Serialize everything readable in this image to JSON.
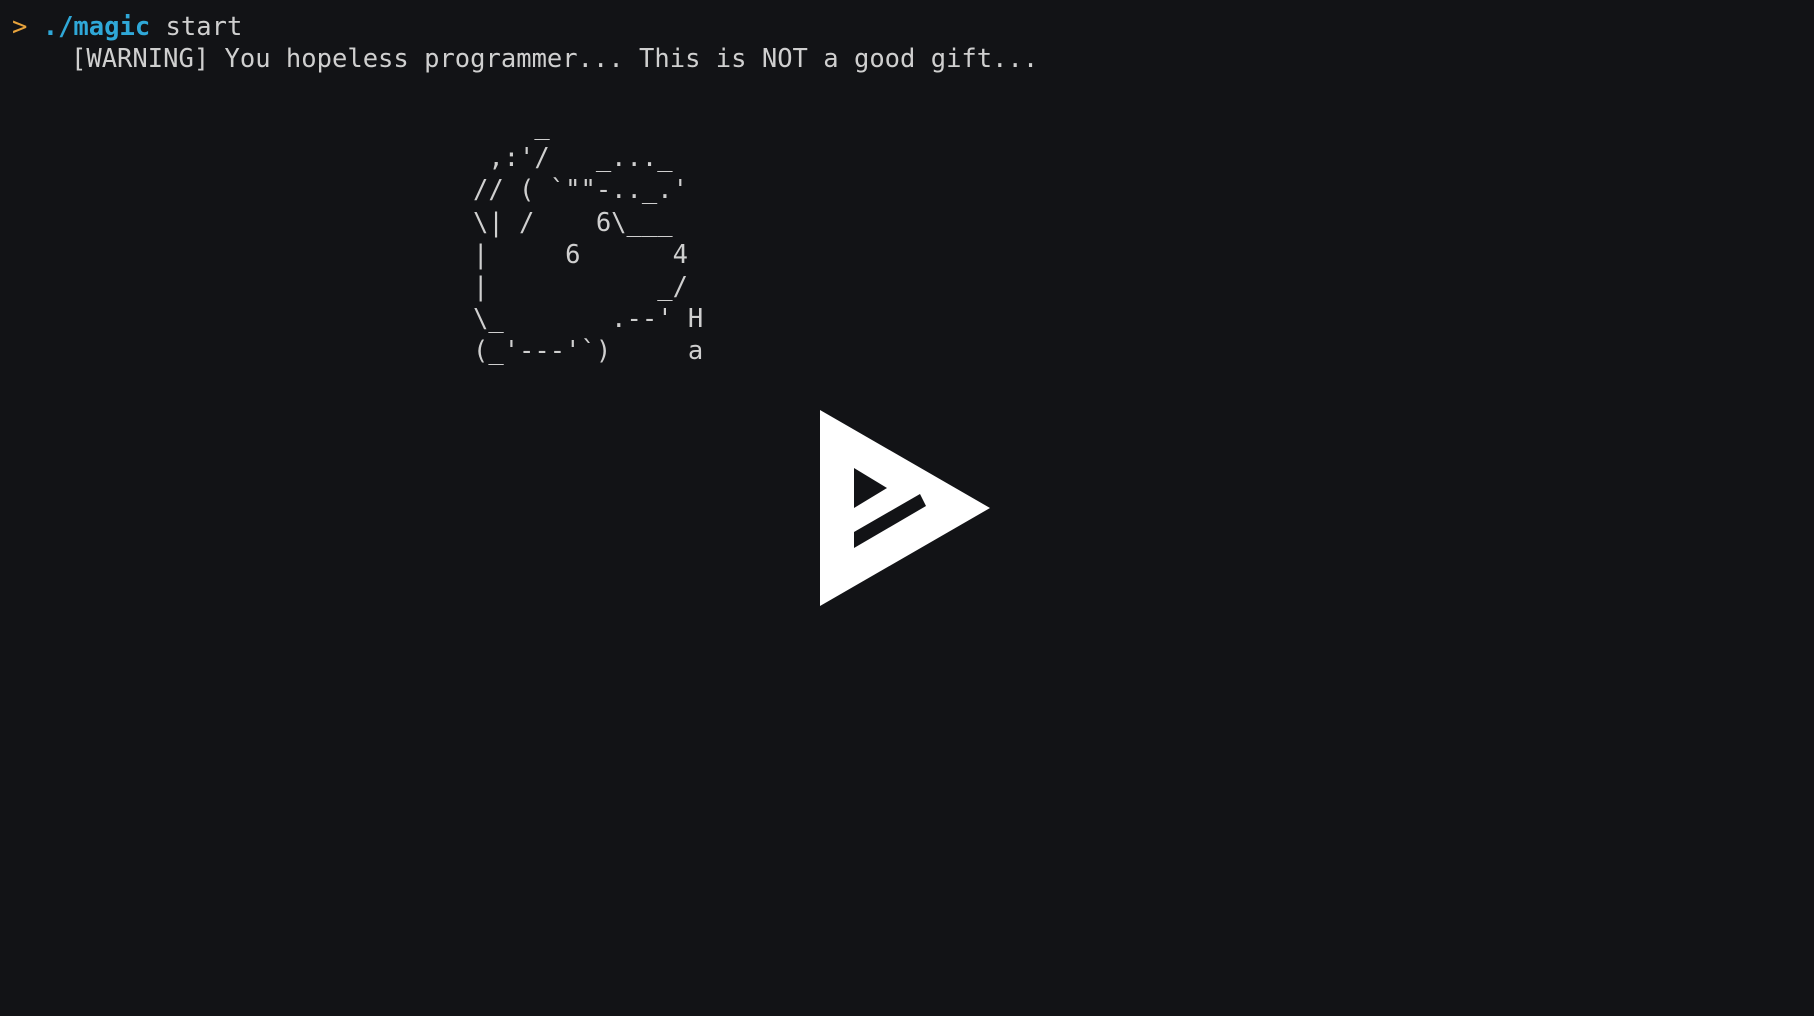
{
  "terminal": {
    "prompt_symbol": ">",
    "command": "./magic",
    "argument": "start",
    "warning": "[WARNING] You hopeless programmer... This is NOT a good gift...",
    "ascii_art": "    _\n ,:'/   _..._\n// ( `\"\"-.._.'\n\\| /    6\\___\n|     6      4\n|           _/\n\\_       .--' H\n(_'---'`)     a"
  },
  "player": {
    "icon": "asciinema-play-icon",
    "color": "#ffffff"
  }
}
